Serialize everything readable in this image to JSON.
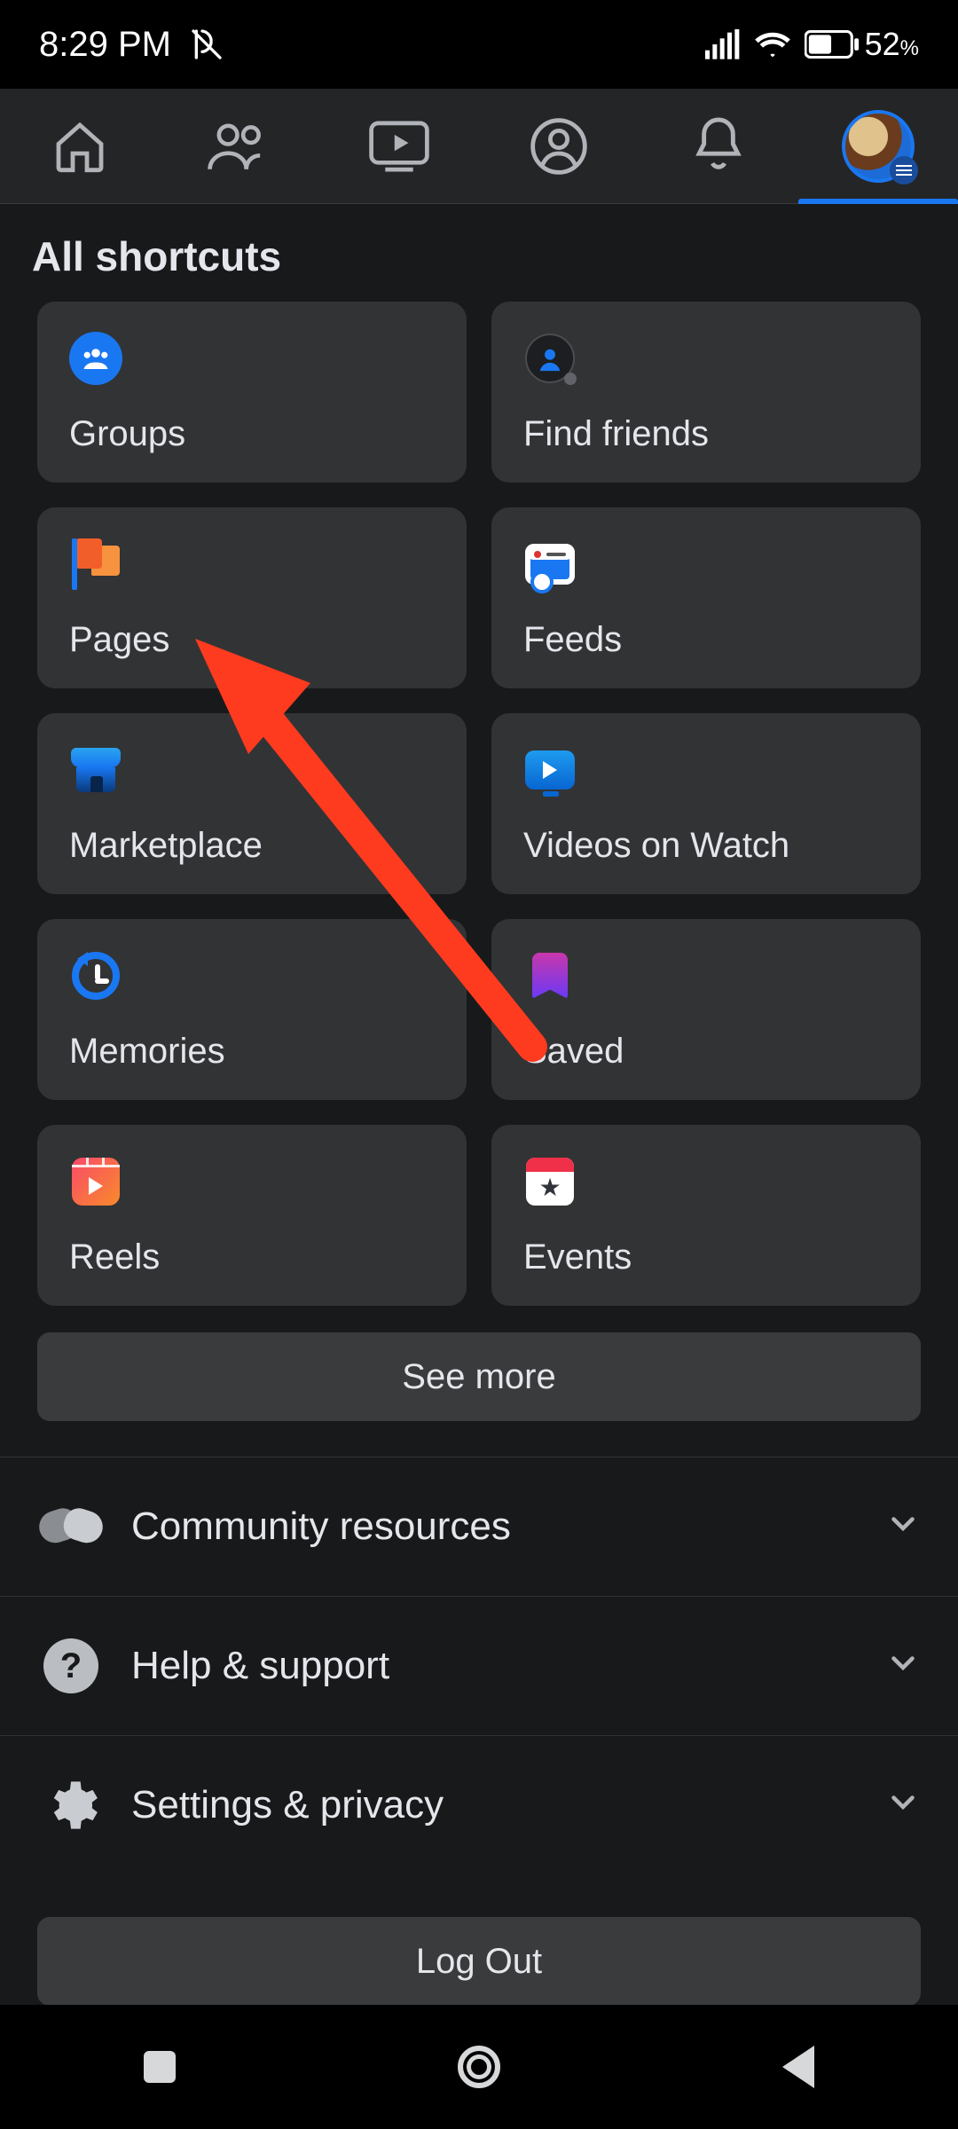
{
  "status": {
    "time": "8:29 PM",
    "battery": "52",
    "battery_suffix": "%"
  },
  "nav": {
    "items": [
      "home",
      "friends",
      "watch",
      "profile",
      "notifications",
      "menu"
    ],
    "active": "menu"
  },
  "section": {
    "title": "All shortcuts"
  },
  "tiles": [
    {
      "key": "groups",
      "label": "Groups"
    },
    {
      "key": "find-friends",
      "label": "Find friends"
    },
    {
      "key": "pages",
      "label": "Pages"
    },
    {
      "key": "feeds",
      "label": "Feeds"
    },
    {
      "key": "marketplace",
      "label": "Marketplace"
    },
    {
      "key": "videos",
      "label": "Videos on Watch"
    },
    {
      "key": "memories",
      "label": "Memories"
    },
    {
      "key": "saved",
      "label": "Saved"
    },
    {
      "key": "reels",
      "label": "Reels"
    },
    {
      "key": "events",
      "label": "Events"
    }
  ],
  "see_more": "See more",
  "rows": [
    {
      "key": "community",
      "label": "Community resources"
    },
    {
      "key": "help",
      "label": "Help & support"
    },
    {
      "key": "settings",
      "label": "Settings & privacy"
    }
  ],
  "logout": "Log Out",
  "annotation": {
    "type": "arrow",
    "target": "pages"
  }
}
